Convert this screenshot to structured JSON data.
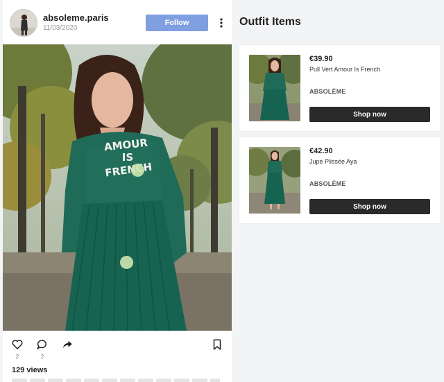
{
  "post": {
    "username": "absoleme.paris",
    "date": "11/03/2020",
    "follow_label": "Follow",
    "likes": "2",
    "comments": "2",
    "views": "129 views",
    "photo_text": [
      "AMOUR",
      "IS",
      "FRENCH"
    ]
  },
  "outfit": {
    "title": "Outfit Items",
    "items": [
      {
        "price": "€39.90",
        "name": "Pull Vert Amour Is French",
        "brand": "ABSOLÈME",
        "button": "Shop now"
      },
      {
        "price": "€42.90",
        "name": "Jupe Plissée Aya",
        "brand": "ABSOLÈME",
        "button": "Shop now"
      }
    ]
  },
  "colors": {
    "follow_button": "#7f9fe0",
    "shop_button": "#2a2a2a",
    "garment_green": "#1f6b57",
    "hotspot": "#cde6af"
  },
  "icons": [
    "more-vertical-icon",
    "heart-icon",
    "comment-icon",
    "share-icon",
    "bookmark-icon"
  ]
}
